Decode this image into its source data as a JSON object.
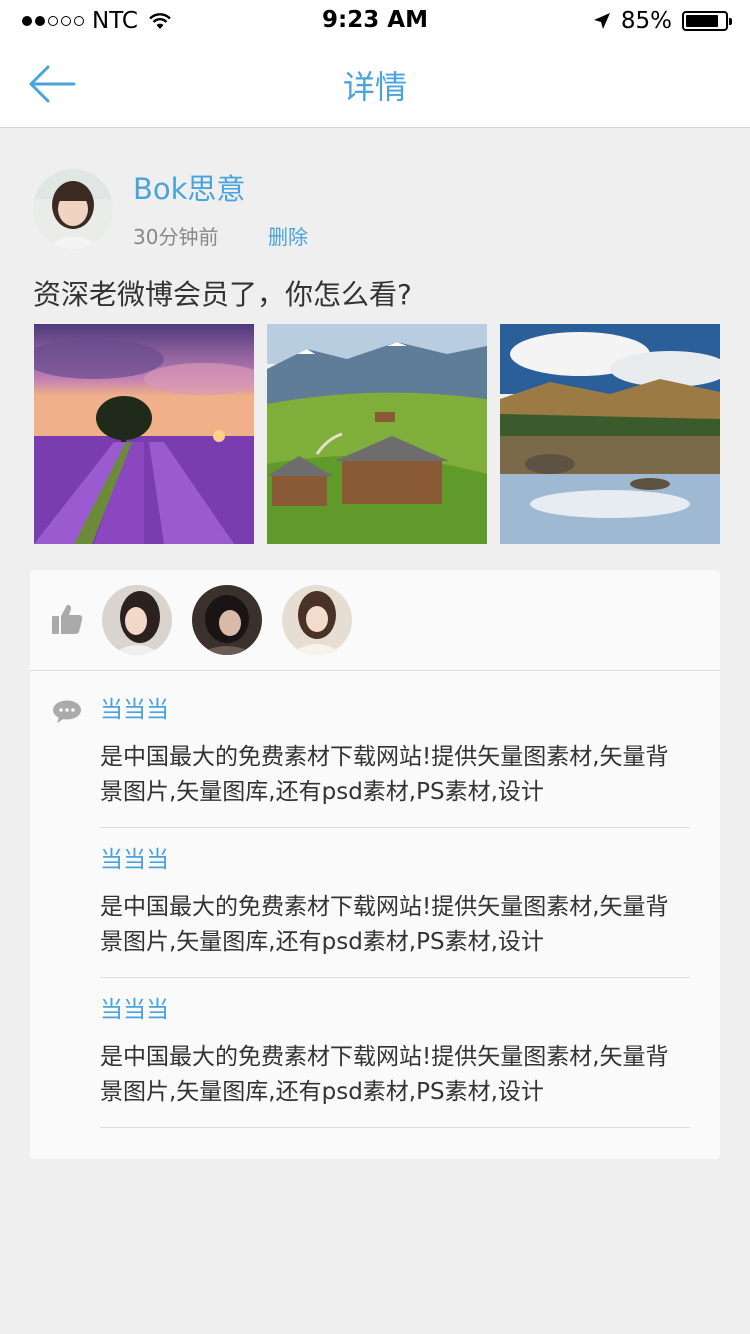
{
  "status_bar": {
    "carrier": "NTC",
    "time": "9:23 AM",
    "battery": "85%",
    "battery_level": 0.85
  },
  "nav": {
    "title": "详情"
  },
  "post": {
    "author": "Bok思意",
    "time": "30分钟前",
    "delete_label": "删除",
    "text": "资深老微博会员了，你怎么看?",
    "photos": [
      "lavender-field-photo",
      "mountain-cabin-photo",
      "lake-reflection-photo"
    ]
  },
  "likes": {
    "icon": "thumbs-up-icon",
    "avatars": [
      "liker-avatar",
      "liker-avatar",
      "liker-avatar"
    ]
  },
  "comments": {
    "icon": "comment-bubble-icon",
    "items": [
      {
        "name": "当当当",
        "text": "是中国最大的免费素材下载网站!提供矢量图素材,矢量背景图片,矢量图库,还有psd素材,PS素材,设计"
      },
      {
        "name": "当当当",
        "text": "是中国最大的免费素材下载网站!提供矢量图素材,矢量背景图片,矢量图库,还有psd素材,PS素材,设计"
      },
      {
        "name": "当当当",
        "text": "是中国最大的免费素材下载网站!提供矢量图素材,矢量背景图片,矢量图库,还有psd素材,PS素材,设计"
      }
    ]
  },
  "colors": {
    "accent": "#4aa3dc",
    "background": "#efefef",
    "card": "#fafafa"
  }
}
